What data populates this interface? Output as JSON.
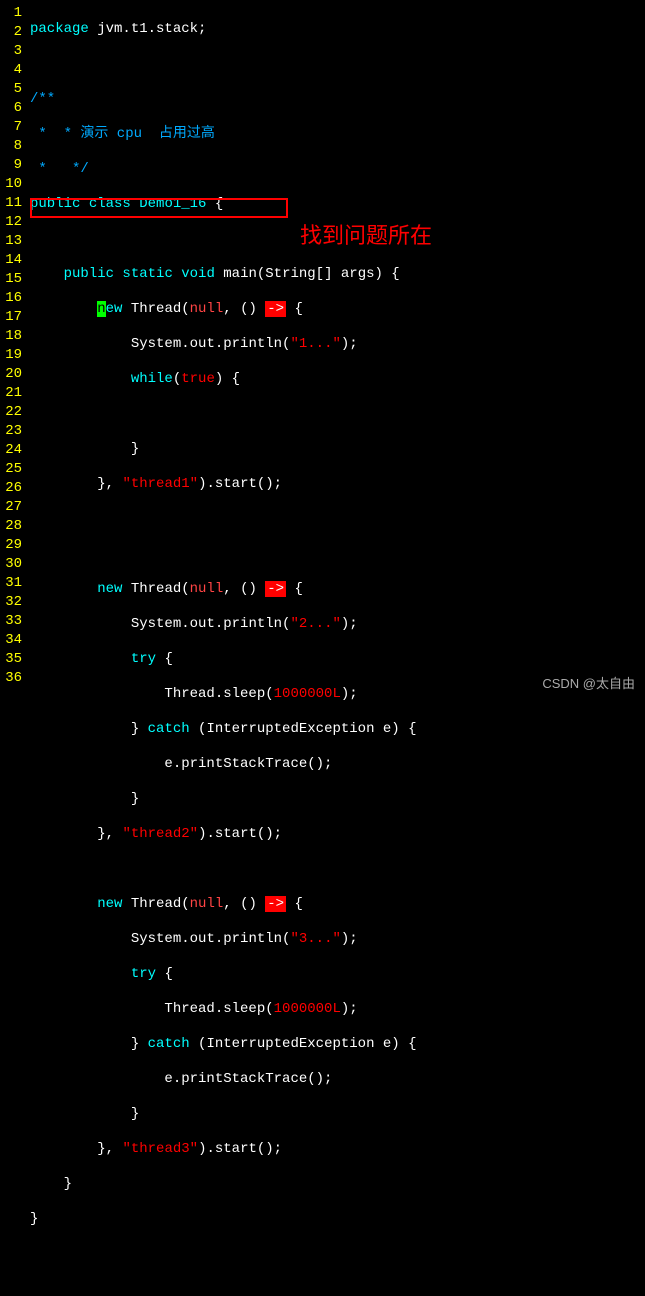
{
  "lines": {
    "ln1": "1",
    "ln2": "2",
    "ln3": "3",
    "ln4": "4",
    "ln5": "5",
    "ln6": "6",
    "ln7": "7",
    "ln8": "8",
    "ln9": "9",
    "ln10": "10",
    "ln11": "11",
    "ln12": "12",
    "ln13": "13",
    "ln14": "14",
    "ln15": "15",
    "ln16": "16",
    "ln17": "17",
    "ln18": "18",
    "ln19": "19",
    "ln20": "20",
    "ln21": "21",
    "ln22": "22",
    "ln23": "23",
    "ln24": "24",
    "ln25": "25",
    "ln26": "26",
    "ln27": "27",
    "ln28": "28",
    "ln29": "29",
    "ln30": "30",
    "ln31": "31",
    "ln32": "32",
    "ln33": "33",
    "ln34": "34",
    "ln35": "35",
    "ln36": "36"
  },
  "tokens": {
    "package": "package",
    "pkgname": " jvm.t1.stack;",
    "c1": "/**",
    "c2": " *  * 演示 cpu  占用过高",
    "c3": " *   */",
    "public": "public",
    "class": " class ",
    "clsName": "Demo1_16",
    "brOpen": " {",
    "static": " static",
    "void": " void ",
    "main": "main",
    "mainArgs": "(String[] args) {",
    "n": "n",
    "ew": "ew",
    "Thread": " Thread(",
    "null": "null",
    "comma": ", ()",
    "arrow": "->",
    "lamOpen": " {",
    "sysout": "System.out.println(",
    "s1": "\"1...\"",
    "s2": "\"2...\"",
    "s3": "\"3...\"",
    "endprint": ");",
    "while": "while",
    "true": "true",
    "whileOpen": "(",
    "whileClose": ") {",
    "closeBr": "}",
    "startCall1a": "}, ",
    "t1": "\"thread1\"",
    "t2": "\"thread2\"",
    "t3": "\"thread3\"",
    "startCall1b": ").start();",
    "new": "new",
    "try": "try",
    "tryOpen": " {",
    "sleep": "Thread.sleep(",
    "sleepNum": "1000000L",
    "sleepEnd": ");",
    "catch": " catch ",
    "catchArgs": "(InterruptedException e) {",
    "stack": "e.printStackTrace();"
  },
  "annotation": "找到问题所在",
  "watermark": "CSDN @太自由"
}
